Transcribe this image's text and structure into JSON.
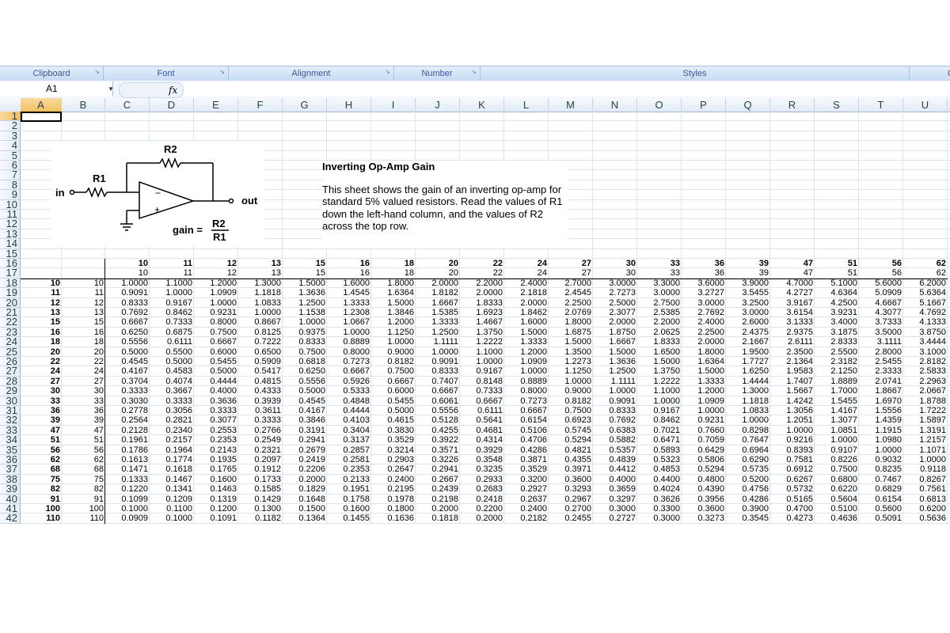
{
  "ribbon": {
    "groups": [
      {
        "label": "Clipboard",
        "launcher": "launcher-icon"
      },
      {
        "label": "Font",
        "launcher": "launcher-icon"
      },
      {
        "label": "Alignment",
        "launcher": "launcher-icon"
      },
      {
        "label": "Number",
        "launcher": "launcher-icon"
      },
      {
        "label": "Styles",
        "launcher": ""
      },
      {
        "label": "C",
        "launcher": ""
      }
    ]
  },
  "formula_bar": {
    "name_box": "A1",
    "fx_label": "fx",
    "formula": ""
  },
  "columns": [
    "A",
    "B",
    "C",
    "D",
    "E",
    "F",
    "G",
    "H",
    "I",
    "J",
    "K",
    "L",
    "M",
    "N",
    "O",
    "P",
    "Q",
    "R",
    "S",
    "T",
    "U"
  ],
  "rows": [
    "1",
    "2",
    "3",
    "4",
    "5",
    "6",
    "7",
    "8",
    "9",
    "10",
    "11",
    "12",
    "13",
    "14",
    "15",
    "16",
    "17",
    "18",
    "19",
    "20",
    "21",
    "22",
    "23",
    "24",
    "25",
    "26",
    "27",
    "28",
    "29",
    "30",
    "31",
    "32",
    "33",
    "34",
    "35",
    "36",
    "37",
    "38",
    "39",
    "40",
    "41",
    "42"
  ],
  "diagram": {
    "r1_label": "R1",
    "r2_label": "R2",
    "in_label": "in",
    "out_label": "out",
    "minus": "−",
    "plus": "+",
    "gain_label": "gain =",
    "gain_num": "R2",
    "gain_den": "R1"
  },
  "description": {
    "title": "Inverting Op-Amp Gain",
    "body": "This sheet shows the gain of an inverting op-amp for standard 5% valued resistors. Read the values of R1 down the left-hand column, and the values of R2 across the top row."
  },
  "table": {
    "r2_values": [
      "10",
      "11",
      "12",
      "13",
      "15",
      "16",
      "18",
      "20",
      "22",
      "24",
      "27",
      "30",
      "33",
      "36",
      "39",
      "47",
      "51",
      "56",
      "62"
    ],
    "r1_values": [
      "10",
      "11",
      "12",
      "13",
      "15",
      "16",
      "18",
      "20",
      "22",
      "24",
      "27",
      "30",
      "33",
      "36",
      "39",
      "47",
      "51",
      "56",
      "62",
      "68",
      "75",
      "82",
      "91",
      "100",
      "110"
    ],
    "gains": [
      [
        "1.0000",
        "1.1000",
        "1.2000",
        "1.3000",
        "1.5000",
        "1.6000",
        "1.8000",
        "2.0000",
        "2.2000",
        "2.4000",
        "2.7000",
        "3.0000",
        "3.3000",
        "3.6000",
        "3.9000",
        "4.7000",
        "5.1000",
        "5.6000",
        "6.2000"
      ],
      [
        "0.9091",
        "1.0000",
        "1.0909",
        "1.1818",
        "1.3636",
        "1.4545",
        "1.6364",
        "1.8182",
        "2.0000",
        "2.1818",
        "2.4545",
        "2.7273",
        "3.0000",
        "3.2727",
        "3.5455",
        "4.2727",
        "4.6364",
        "5.0909",
        "5.6364"
      ],
      [
        "0.8333",
        "0.9167",
        "1.0000",
        "1.0833",
        "1.2500",
        "1.3333",
        "1.5000",
        "1.6667",
        "1.8333",
        "2.0000",
        "2.2500",
        "2.5000",
        "2.7500",
        "3.0000",
        "3.2500",
        "3.9167",
        "4.2500",
        "4.6667",
        "5.1667"
      ],
      [
        "0.7692",
        "0.8462",
        "0.9231",
        "1.0000",
        "1.1538",
        "1.2308",
        "1.3846",
        "1.5385",
        "1.6923",
        "1.8462",
        "2.0769",
        "2.3077",
        "2.5385",
        "2.7692",
        "3.0000",
        "3.6154",
        "3.9231",
        "4.3077",
        "4.7692"
      ],
      [
        "0.6667",
        "0.7333",
        "0.8000",
        "0.8667",
        "1.0000",
        "1.0667",
        "1.2000",
        "1.3333",
        "1.4667",
        "1.6000",
        "1.8000",
        "2.0000",
        "2.2000",
        "2.4000",
        "2.6000",
        "3.1333",
        "3.4000",
        "3.7333",
        "4.1333"
      ],
      [
        "0.6250",
        "0.6875",
        "0.7500",
        "0.8125",
        "0.9375",
        "1.0000",
        "1.1250",
        "1.2500",
        "1.3750",
        "1.5000",
        "1.6875",
        "1.8750",
        "2.0625",
        "2.2500",
        "2.4375",
        "2.9375",
        "3.1875",
        "3.5000",
        "3.8750"
      ],
      [
        "0.5556",
        "0.6111",
        "0.6667",
        "0.7222",
        "0.8333",
        "0.8889",
        "1.0000",
        "1.1111",
        "1.2222",
        "1.3333",
        "1.5000",
        "1.6667",
        "1.8333",
        "2.0000",
        "2.1667",
        "2.6111",
        "2.8333",
        "3.1111",
        "3.4444"
      ],
      [
        "0.5000",
        "0.5500",
        "0.6000",
        "0.6500",
        "0.7500",
        "0.8000",
        "0.9000",
        "1.0000",
        "1.1000",
        "1.2000",
        "1.3500",
        "1.5000",
        "1.6500",
        "1.8000",
        "1.9500",
        "2.3500",
        "2.5500",
        "2.8000",
        "3.1000"
      ],
      [
        "0.4545",
        "0.5000",
        "0.5455",
        "0.5909",
        "0.6818",
        "0.7273",
        "0.8182",
        "0.9091",
        "1.0000",
        "1.0909",
        "1.2273",
        "1.3636",
        "1.5000",
        "1.6364",
        "1.7727",
        "2.1364",
        "2.3182",
        "2.5455",
        "2.8182"
      ],
      [
        "0.4167",
        "0.4583",
        "0.5000",
        "0.5417",
        "0.6250",
        "0.6667",
        "0.7500",
        "0.8333",
        "0.9167",
        "1.0000",
        "1.1250",
        "1.2500",
        "1.3750",
        "1.5000",
        "1.6250",
        "1.9583",
        "2.1250",
        "2.3333",
        "2.5833"
      ],
      [
        "0.3704",
        "0.4074",
        "0.4444",
        "0.4815",
        "0.5556",
        "0.5926",
        "0.6667",
        "0.7407",
        "0.8148",
        "0.8889",
        "1.0000",
        "1.1111",
        "1.2222",
        "1.3333",
        "1.4444",
        "1.7407",
        "1.8889",
        "2.0741",
        "2.2963"
      ],
      [
        "0.3333",
        "0.3667",
        "0.4000",
        "0.4333",
        "0.5000",
        "0.5333",
        "0.6000",
        "0.6667",
        "0.7333",
        "0.8000",
        "0.9000",
        "1.0000",
        "1.1000",
        "1.2000",
        "1.3000",
        "1.5667",
        "1.7000",
        "1.8667",
        "2.0667"
      ],
      [
        "0.3030",
        "0.3333",
        "0.3636",
        "0.3939",
        "0.4545",
        "0.4848",
        "0.5455",
        "0.6061",
        "0.6667",
        "0.7273",
        "0.8182",
        "0.9091",
        "1.0000",
        "1.0909",
        "1.1818",
        "1.4242",
        "1.5455",
        "1.6970",
        "1.8788"
      ],
      [
        "0.2778",
        "0.3056",
        "0.3333",
        "0.3611",
        "0.4167",
        "0.4444",
        "0.5000",
        "0.5556",
        "0.6111",
        "0.6667",
        "0.7500",
        "0.8333",
        "0.9167",
        "1.0000",
        "1.0833",
        "1.3056",
        "1.4167",
        "1.5556",
        "1.7222"
      ],
      [
        "0.2564",
        "0.2821",
        "0.3077",
        "0.3333",
        "0.3846",
        "0.4103",
        "0.4615",
        "0.5128",
        "0.5641",
        "0.6154",
        "0.6923",
        "0.7692",
        "0.8462",
        "0.9231",
        "1.0000",
        "1.2051",
        "1.3077",
        "1.4359",
        "1.5897"
      ],
      [
        "0.2128",
        "0.2340",
        "0.2553",
        "0.2766",
        "0.3191",
        "0.3404",
        "0.3830",
        "0.4255",
        "0.4681",
        "0.5106",
        "0.5745",
        "0.6383",
        "0.7021",
        "0.7660",
        "0.8298",
        "1.0000",
        "1.0851",
        "1.1915",
        "1.3191"
      ],
      [
        "0.1961",
        "0.2157",
        "0.2353",
        "0.2549",
        "0.2941",
        "0.3137",
        "0.3529",
        "0.3922",
        "0.4314",
        "0.4706",
        "0.5294",
        "0.5882",
        "0.6471",
        "0.7059",
        "0.7647",
        "0.9216",
        "1.0000",
        "1.0980",
        "1.2157"
      ],
      [
        "0.1786",
        "0.1964",
        "0.2143",
        "0.2321",
        "0.2679",
        "0.2857",
        "0.3214",
        "0.3571",
        "0.3929",
        "0.4286",
        "0.4821",
        "0.5357",
        "0.5893",
        "0.6429",
        "0.6964",
        "0.8393",
        "0.9107",
        "1.0000",
        "1.1071"
      ],
      [
        "0.1613",
        "0.1774",
        "0.1935",
        "0.2097",
        "0.2419",
        "0.2581",
        "0.2903",
        "0.3226",
        "0.3548",
        "0.3871",
        "0.4355",
        "0.4839",
        "0.5323",
        "0.5806",
        "0.6290",
        "0.7581",
        "0.8226",
        "0.9032",
        "1.0000"
      ],
      [
        "0.1471",
        "0.1618",
        "0.1765",
        "0.1912",
        "0.2206",
        "0.2353",
        "0.2647",
        "0.2941",
        "0.3235",
        "0.3529",
        "0.3971",
        "0.4412",
        "0.4853",
        "0.5294",
        "0.5735",
        "0.6912",
        "0.7500",
        "0.8235",
        "0.9118"
      ],
      [
        "0.1333",
        "0.1467",
        "0.1600",
        "0.1733",
        "0.2000",
        "0.2133",
        "0.2400",
        "0.2667",
        "0.2933",
        "0.3200",
        "0.3600",
        "0.4000",
        "0.4400",
        "0.4800",
        "0.5200",
        "0.6267",
        "0.6800",
        "0.7467",
        "0.8267"
      ],
      [
        "0.1220",
        "0.1341",
        "0.1463",
        "0.1585",
        "0.1829",
        "0.1951",
        "0.2195",
        "0.2439",
        "0.2683",
        "0.2927",
        "0.3293",
        "0.3659",
        "0.4024",
        "0.4390",
        "0.4756",
        "0.5732",
        "0.6220",
        "0.6829",
        "0.7561"
      ],
      [
        "0.1099",
        "0.1209",
        "0.1319",
        "0.1429",
        "0.1648",
        "0.1758",
        "0.1978",
        "0.2198",
        "0.2418",
        "0.2637",
        "0.2967",
        "0.3297",
        "0.3626",
        "0.3956",
        "0.4286",
        "0.5165",
        "0.5604",
        "0.6154",
        "0.6813"
      ],
      [
        "0.1000",
        "0.1100",
        "0.1200",
        "0.1300",
        "0.1500",
        "0.1600",
        "0.1800",
        "0.2000",
        "0.2200",
        "0.2400",
        "0.2700",
        "0.3000",
        "0.3300",
        "0.3600",
        "0.3900",
        "0.4700",
        "0.5100",
        "0.5600",
        "0.6200"
      ],
      [
        "0.0909",
        "0.1000",
        "0.1091",
        "0.1182",
        "0.1364",
        "0.1455",
        "0.1636",
        "0.1818",
        "0.2000",
        "0.2182",
        "0.2455",
        "0.2727",
        "0.3000",
        "0.3273",
        "0.3545",
        "0.4273",
        "0.4636",
        "0.5091",
        "0.5636"
      ]
    ]
  },
  "colors": {
    "selected_header": "#f1c15f",
    "ribbon_text": "#3b5998",
    "grid_line": "#dde4ee"
  }
}
